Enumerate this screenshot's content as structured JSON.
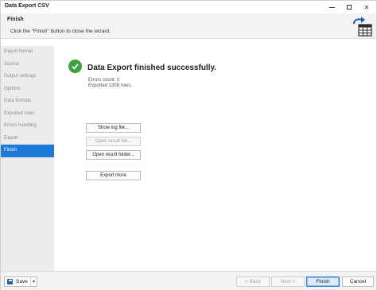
{
  "window": {
    "title": "Data Export CSV"
  },
  "header": {
    "title": "Finish",
    "subtitle": "Click the \"Finish\" button to close the wizard."
  },
  "sidebar": {
    "items": [
      {
        "label": "Export format",
        "active": false
      },
      {
        "label": "Source",
        "active": false
      },
      {
        "label": "Output settings",
        "active": false
      },
      {
        "label": "Options",
        "active": false
      },
      {
        "label": "Data formats",
        "active": false
      },
      {
        "label": "Exported rows",
        "active": false
      },
      {
        "label": "Errors handling",
        "active": false
      },
      {
        "label": "Export",
        "active": false
      },
      {
        "label": "Finish",
        "active": true
      }
    ]
  },
  "main": {
    "status_title": "Data Export finished successfully.",
    "errors_count": "Errors count: 0",
    "exported_rows": "Exported 1308 rows.",
    "buttons": {
      "show_log": "Show log file...",
      "open_result_file": "Open result file...",
      "open_result_folder": "Open result folder...",
      "export_more": "Export more"
    }
  },
  "footer": {
    "save": "Save",
    "back": "< Back",
    "next": "Next >",
    "finish": "Finish",
    "cancel": "Cancel"
  },
  "colors": {
    "accent": "#1d7bd8",
    "success": "#3aa040",
    "sidebar_bg": "#ececec"
  },
  "icons": [
    "check-circle-icon",
    "export-table-icon",
    "save-icon",
    "chevron-down-icon",
    "minimize-icon",
    "maximize-icon",
    "close-icon"
  ]
}
